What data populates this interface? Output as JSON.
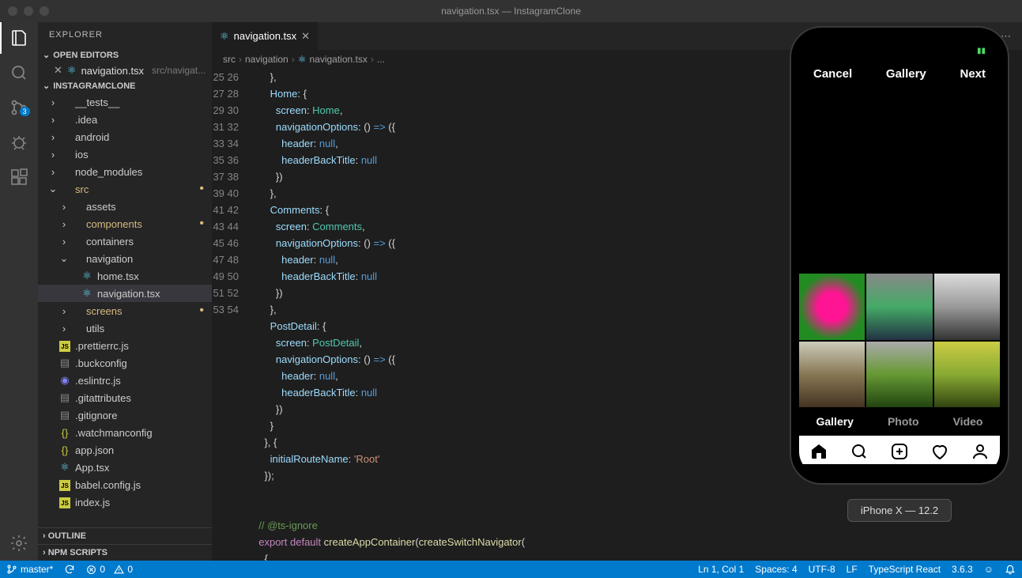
{
  "window": {
    "title": "navigation.tsx — InstagramClone"
  },
  "explorer": {
    "title": "EXPLORER",
    "openEditors": {
      "label": "OPEN EDITORS"
    },
    "openFile": {
      "name": "navigation.tsx",
      "path": "src/navigat..."
    },
    "project": "INSTAGRAMCLONE",
    "tree": [
      {
        "indent": 0,
        "arrow": ">",
        "icon": "folder",
        "label": "__tests__"
      },
      {
        "indent": 0,
        "arrow": ">",
        "icon": "folder",
        "label": ".idea"
      },
      {
        "indent": 0,
        "arrow": ">",
        "icon": "folder",
        "label": "android"
      },
      {
        "indent": 0,
        "arrow": ">",
        "icon": "folder",
        "label": "ios"
      },
      {
        "indent": 0,
        "arrow": ">",
        "icon": "folder",
        "label": "node_modules"
      },
      {
        "indent": 0,
        "arrow": "v",
        "icon": "folder",
        "label": "src",
        "mod": true
      },
      {
        "indent": 1,
        "arrow": ">",
        "icon": "folder",
        "label": "assets"
      },
      {
        "indent": 1,
        "arrow": ">",
        "icon": "folder",
        "label": "components",
        "mod": true
      },
      {
        "indent": 1,
        "arrow": ">",
        "icon": "folder",
        "label": "containers"
      },
      {
        "indent": 1,
        "arrow": "v",
        "icon": "folder",
        "label": "navigation"
      },
      {
        "indent": 2,
        "arrow": "",
        "icon": "react",
        "label": "home.tsx"
      },
      {
        "indent": 2,
        "arrow": "",
        "icon": "react",
        "label": "navigation.tsx",
        "selected": true
      },
      {
        "indent": 1,
        "arrow": ">",
        "icon": "folder",
        "label": "screens",
        "mod": true
      },
      {
        "indent": 1,
        "arrow": ">",
        "icon": "folder",
        "label": "utils"
      },
      {
        "indent": 0,
        "arrow": "",
        "icon": "js",
        "label": ".prettierrc.js"
      },
      {
        "indent": 0,
        "arrow": "",
        "icon": "file",
        "label": ".buckconfig"
      },
      {
        "indent": 0,
        "arrow": "",
        "icon": "eslint",
        "label": ".eslintrc.js"
      },
      {
        "indent": 0,
        "arrow": "",
        "icon": "file",
        "label": ".gitattributes"
      },
      {
        "indent": 0,
        "arrow": "",
        "icon": "file",
        "label": ".gitignore"
      },
      {
        "indent": 0,
        "arrow": "",
        "icon": "json",
        "label": ".watchmanconfig"
      },
      {
        "indent": 0,
        "arrow": "",
        "icon": "json",
        "label": "app.json"
      },
      {
        "indent": 0,
        "arrow": "",
        "icon": "react",
        "label": "App.tsx"
      },
      {
        "indent": 0,
        "arrow": "",
        "icon": "js",
        "label": "babel.config.js"
      },
      {
        "indent": 0,
        "arrow": "",
        "icon": "js",
        "label": "index.js"
      }
    ],
    "outline": "OUTLINE",
    "npmscripts": "NPM SCRIPTS"
  },
  "tab": {
    "label": "navigation.tsx"
  },
  "breadcrumb": {
    "parts": [
      "src",
      "navigation",
      "navigation.tsx",
      "..."
    ]
  },
  "code": {
    "start": 25,
    "lines": [
      "      },",
      "      Home: {",
      "        screen: Home,",
      "        navigationOptions: () => ({",
      "          header: null,",
      "          headerBackTitle: null",
      "        })",
      "      },",
      "      Comments: {",
      "        screen: Comments,",
      "        navigationOptions: () => ({",
      "          header: null,",
      "          headerBackTitle: null",
      "        })",
      "      },",
      "      PostDetail: {",
      "        screen: PostDetail,",
      "        navigationOptions: () => ({",
      "          header: null,",
      "          headerBackTitle: null",
      "        })",
      "      }",
      "    }, {",
      "      initialRouteName: 'Root'",
      "    });",
      "",
      "",
      "  // @ts-ignore",
      "  export default createAppContainer(createSwitchNavigator(",
      "    {"
    ]
  },
  "statusbar": {
    "branch": "master*",
    "sync": "",
    "errors": "0",
    "warnings": "0",
    "position": "Ln 1, Col 1",
    "spaces": "Spaces: 4",
    "encoding": "UTF-8",
    "eol": "LF",
    "lang": "TypeScript React",
    "version": "3.6.3"
  },
  "phone": {
    "cancel": "Cancel",
    "title": "Gallery",
    "next": "Next",
    "modes": [
      "Gallery",
      "Photo",
      "Video"
    ],
    "device": "iPhone X — 12.2"
  },
  "scm_badge": "3"
}
